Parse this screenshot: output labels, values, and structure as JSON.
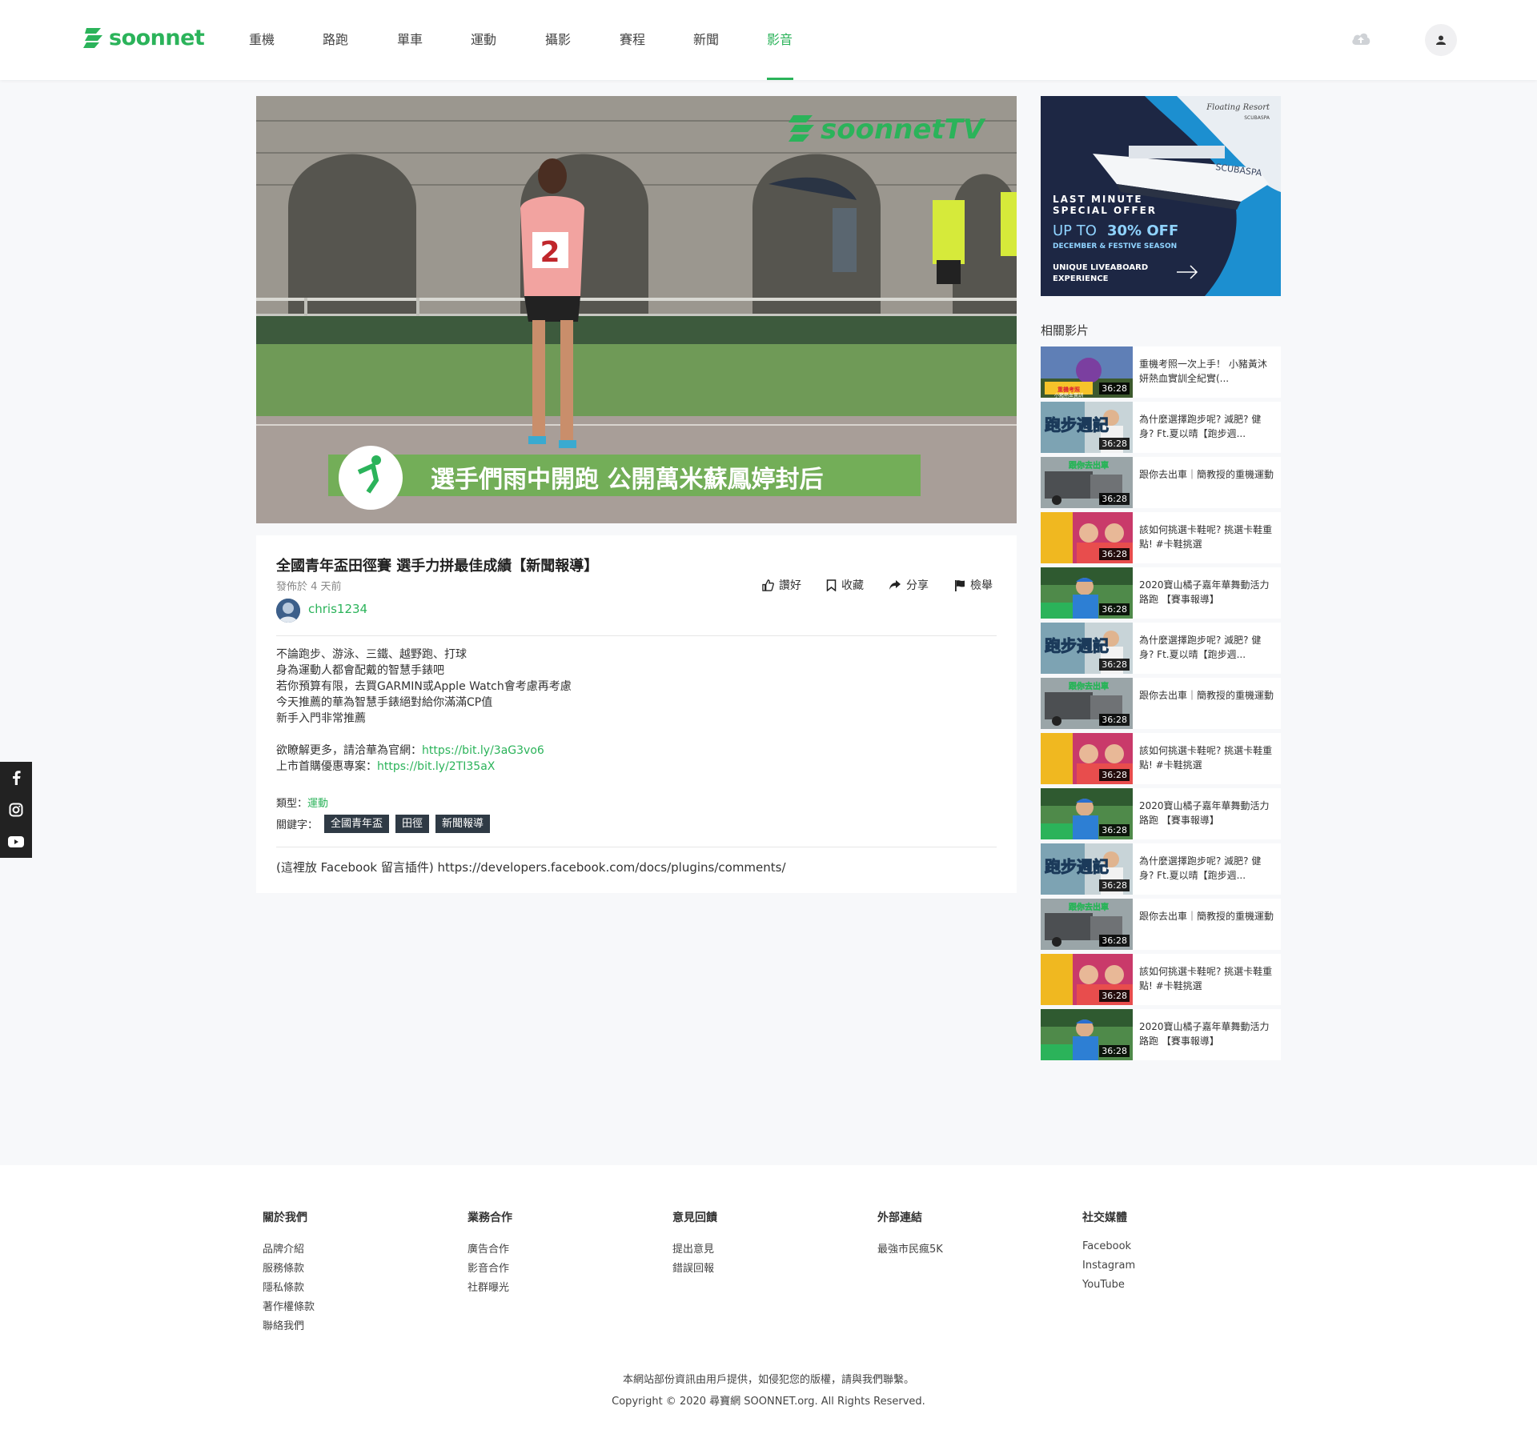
{
  "brand": {
    "name": "soonnet",
    "accent": "#2bb35a"
  },
  "nav": {
    "items": [
      {
        "label": "重機"
      },
      {
        "label": "路跑"
      },
      {
        "label": "單車"
      },
      {
        "label": "運動"
      },
      {
        "label": "攝影"
      },
      {
        "label": "賽程"
      },
      {
        "label": "新聞"
      },
      {
        "label": "影音"
      }
    ],
    "active": "影音"
  },
  "header_icons": {
    "upload": "cloud-upload-icon",
    "user": "user-icon"
  },
  "video": {
    "watermark": "soonnetTV",
    "caption": "選手們雨中開跑 公開萬米蘇鳳婷封后",
    "bib": "2"
  },
  "info": {
    "title": "全國青年盃田徑賽 選手力拼最佳成績【新聞報導】",
    "posted": "發佈於 4 天前",
    "author": "chris1234",
    "actions": {
      "like": "讚好",
      "save": "收藏",
      "share": "分享",
      "report": "檢舉"
    },
    "description": [
      "不論跑步、游泳、三鐵、越野跑、打球",
      "身為運動人都會配戴的智慧手錶吧",
      "若你預算有限，去買GARMIN或Apple Watch會考慮再考慮",
      "今天推薦的華為智慧手錶絕對給你滿滿CP值",
      "新手入門非常推薦"
    ],
    "more_prefix": "欲瞭解更多，請洽華為官網：",
    "more_link": "https://bit.ly/3aG3vo6",
    "promo_prefix": "上市首購優惠專案：",
    "promo_link": "https://bit.ly/2TI35aX",
    "category_label": "類型：",
    "category": "運動",
    "keywords_label": "關鍵字：",
    "keywords": [
      "全國青年盃",
      "田徑",
      "新聞報導"
    ],
    "comment_placeholder": "(這裡放 Facebook 留言插件) https://developers.facebook.com/docs/plugins/comments/"
  },
  "ad": {
    "brand_script": "Floating Resort",
    "brand": "SCUBASPA",
    "ship_name": "SCUBASPA",
    "line1": "LAST MINUTE",
    "line2": "SPECIAL OFFER",
    "offer_prefix": "UP TO ",
    "offer_value": "30% OFF",
    "season": "DECEMBER & FESTIVE SEASON",
    "tag1": "UNIQUE LIVEABOARD",
    "tag2": "EXPERIENCE"
  },
  "related": {
    "title": "相關影片",
    "items": [
      {
        "title": "重機考照一次上手！ 小豬黃沐妍熱血實訓全紀實(...",
        "duration": "36:28",
        "thumb": "moto",
        "overlay_1": "重機考照",
        "overlay_2": "小豬熱血實訓"
      },
      {
        "title": "為什麼選擇跑步呢? 減肥? 健身? Ft.夏以晴【跑步週...",
        "duration": "36:28",
        "thumb": "runner",
        "overlay_1": "跑步週記"
      },
      {
        "title": "跟你去出車｜簡教授的重機運動",
        "duration": "36:28",
        "thumb": "truck",
        "overlay_1": "跟你去出車"
      },
      {
        "title": "該如何挑選卡鞋呢? 挑選卡鞋重點! #卡鞋挑選",
        "duration": "36:28",
        "thumb": "shoes"
      },
      {
        "title": "2020寶山橘子嘉年華舞動活力路跑 【賽事報導】",
        "duration": "36:28",
        "thumb": "race"
      },
      {
        "title": "為什麼選擇跑步呢? 減肥? 健身? Ft.夏以晴【跑步週...",
        "duration": "36:28",
        "thumb": "runner",
        "overlay_1": "跑步週記"
      },
      {
        "title": "跟你去出車｜簡教授的重機運動",
        "duration": "36:28",
        "thumb": "truck",
        "overlay_1": "跟你去出車"
      },
      {
        "title": "該如何挑選卡鞋呢? 挑選卡鞋重點! #卡鞋挑選",
        "duration": "36:28",
        "thumb": "shoes"
      },
      {
        "title": "2020寶山橘子嘉年華舞動活力路跑 【賽事報導】",
        "duration": "36:28",
        "thumb": "race"
      },
      {
        "title": "為什麼選擇跑步呢? 減肥? 健身? Ft.夏以晴【跑步週...",
        "duration": "36:28",
        "thumb": "runner",
        "overlay_1": "跑步週記"
      },
      {
        "title": "跟你去出車｜簡教授的重機運動",
        "duration": "36:28",
        "thumb": "truck",
        "overlay_1": "跟你去出車"
      },
      {
        "title": "該如何挑選卡鞋呢? 挑選卡鞋重點! #卡鞋挑選",
        "duration": "36:28",
        "thumb": "shoes"
      },
      {
        "title": "2020寶山橘子嘉年華舞動活力路跑 【賽事報導】",
        "duration": "36:28",
        "thumb": "race"
      }
    ]
  },
  "social_bar": [
    "facebook-icon",
    "instagram-icon",
    "youtube-icon"
  ],
  "footer": {
    "columns": [
      {
        "heading": "關於我們",
        "links": [
          "品牌介紹",
          "服務條款",
          "隱私條款",
          "著作權條款",
          "聯絡我們"
        ]
      },
      {
        "heading": "業務合作",
        "links": [
          "廣告合作",
          "影音合作",
          "社群曝光"
        ]
      },
      {
        "heading": "意見回饋",
        "links": [
          "提出意見",
          "錯誤回報"
        ]
      },
      {
        "heading": "外部連結",
        "links": [
          "最強市民瘋5K"
        ]
      },
      {
        "heading": "社交媒體",
        "links": [
          "Facebook",
          "Instagram",
          "YouTube"
        ]
      }
    ],
    "notice": "本網站部份資訊由用戶提供，如侵犯您的版權，請與我們聯繫。",
    "copyright": "Copyright © 2020 尋寶網 SOONNET.org. All Rights Reserved."
  }
}
